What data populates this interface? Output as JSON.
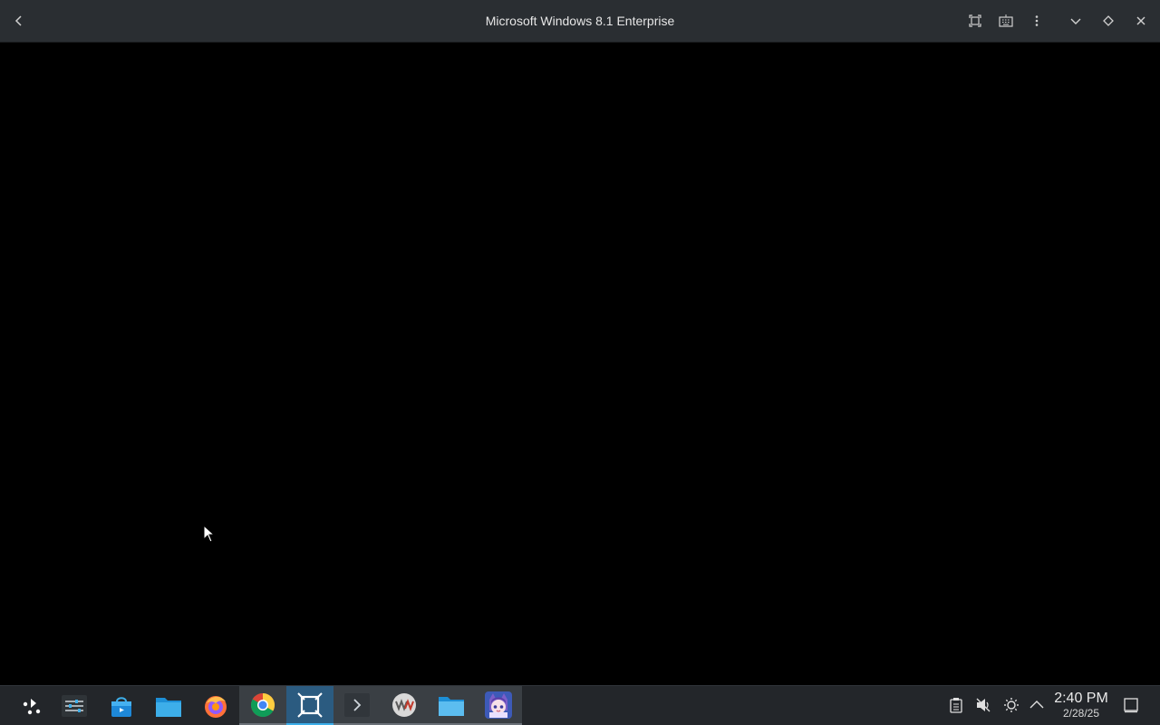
{
  "window": {
    "title": "Microsoft Windows 8.1 Enterprise",
    "buttons": [
      "back-icon",
      "fullscreen-icon",
      "keyboard-icon",
      "more-vert-icon",
      "minimize-icon",
      "keep-above-icon",
      "close-icon"
    ]
  },
  "taskbar": {
    "apps": [
      {
        "name": "application-launcher",
        "icon": "launcher-icon"
      },
      {
        "name": "system-settings",
        "icon": "settings-sliders-icon"
      },
      {
        "name": "discover-store",
        "icon": "store-bag-icon"
      },
      {
        "name": "file-manager",
        "icon": "folder-icon"
      },
      {
        "name": "firefox",
        "icon": "firefox-icon"
      },
      {
        "name": "chrome",
        "icon": "chrome-icon"
      },
      {
        "name": "virt-manager",
        "icon": "vm-frame-icon"
      },
      {
        "name": "terminal",
        "icon": "terminal-icon"
      },
      {
        "name": "vmware",
        "icon": "vmware-icon"
      },
      {
        "name": "folder-window",
        "icon": "folder-window-icon"
      },
      {
        "name": "anime-app",
        "icon": "avatar-icon"
      }
    ],
    "tray": {
      "icons": [
        "clipboard-icon",
        "volume-muted-icon",
        "brightness-icon",
        "tray-expand-icon"
      ],
      "time": "2:40 PM",
      "date": "2/28/25"
    }
  },
  "colors": {
    "titlebar": "#2a2e32",
    "taskbar": "#23262a",
    "accent": "#3daee9"
  }
}
